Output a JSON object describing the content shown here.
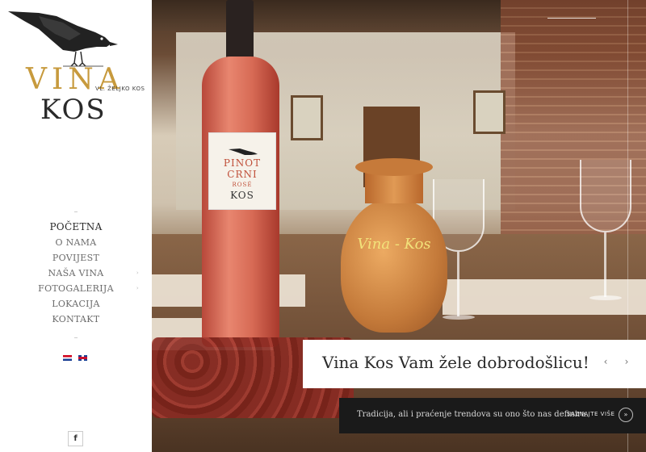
{
  "logo": {
    "word1": "VINA",
    "subtitle": "VL. ŽELJKO KOS",
    "word2": "KOS"
  },
  "nav": {
    "items": [
      {
        "label": "POČETNA",
        "active": true,
        "has_submenu": false
      },
      {
        "label": "O NAMA",
        "active": false,
        "has_submenu": false
      },
      {
        "label": "POVIJEST",
        "active": false,
        "has_submenu": false
      },
      {
        "label": "NAŠA VINA",
        "active": false,
        "has_submenu": true
      },
      {
        "label": "FOTOGALERIJA",
        "active": false,
        "has_submenu": true
      },
      {
        "label": "LOKACIJA",
        "active": false,
        "has_submenu": false
      },
      {
        "label": "KONTAKT",
        "active": false,
        "has_submenu": false
      }
    ],
    "submenu_arrow": "›"
  },
  "languages": [
    {
      "icon": "croatia-flag-icon"
    },
    {
      "icon": "uk-flag-icon"
    }
  ],
  "social": {
    "facebook_label": "f"
  },
  "hero": {
    "bottle_label": {
      "line1": "PINOT",
      "line2": "CRNI",
      "line3": "ROSÉ",
      "line4": "KOS"
    },
    "jug_text": "Vina - Kos"
  },
  "slider": {
    "caption": "Vina Kos Vam žele dobrodošlicu!",
    "prev_arrow": "‹",
    "next_arrow": "›",
    "tagline": "Tradicija, ali i praćenje trendova su ono što nas definira.",
    "more_label": "SAZNAJTE VIŠE",
    "more_arrow": "»"
  },
  "colors": {
    "accent_gold": "#c79a3d",
    "text_dark": "#2a2a2a",
    "tagline_bg": "#1a1a1a"
  }
}
